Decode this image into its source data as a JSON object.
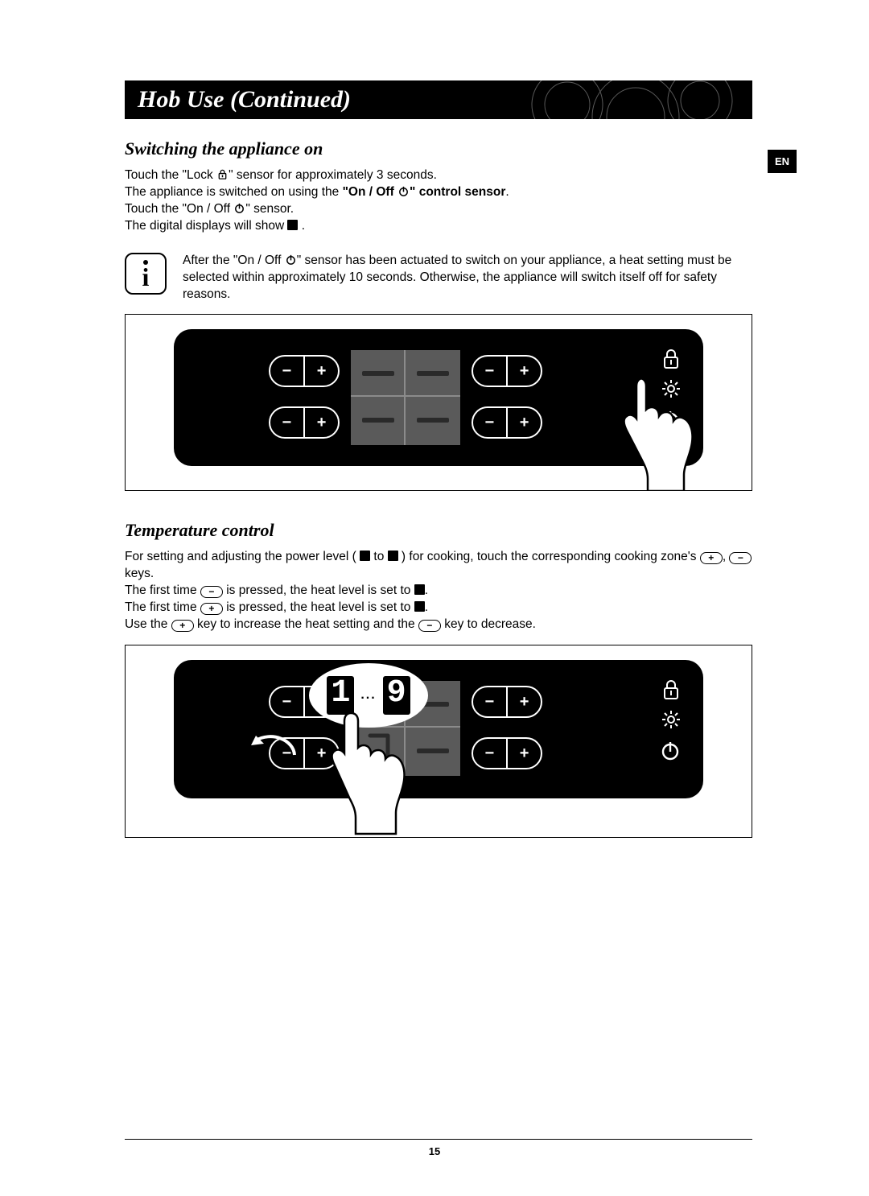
{
  "lang_tab": "EN",
  "page_title": "Hob Use (Continued)",
  "page_number": "15",
  "section1": {
    "heading": "Switching the appliance on",
    "line1a": "Touch the \"Lock ",
    "line1b": "\" sensor for approximately 3 seconds.",
    "line2a": "The appliance is switched on using the ",
    "line2b_bold": "\"On / Off ",
    "line2c_bold": "\" control sensor",
    "line2d": ".",
    "line3a": "Touch the \"On / Off ",
    "line3b": "\" sensor.",
    "line4a": "The digital displays will show ",
    "line4b": " .",
    "info": "After the \"On / Off Ⓘ\" sensor has been actuated to switch on your appliance, a heat setting must be selected within approximately 10 seconds. Otherwise, the appliance will switch itself off for safety reasons.",
    "info_a": "After the \"On / Off ",
    "info_b": "\" sensor has been actuated to switch on your appliance, a heat setting must be selected within approximately 10 seconds. Otherwise, the appliance will switch itself off for safety reasons."
  },
  "section2": {
    "heading": "Temperature control",
    "p1a": "For setting and adjusting the power level ( ",
    "p1b": " to ",
    "p1c": " ) for cooking, touch the corresponding cooking zone's ",
    "p1d": ", ",
    "p1e": " keys.",
    "p2a": "The first time ",
    "p2b": " is pressed, the heat level is set to ",
    "p2c": ".",
    "p3a": "The first time ",
    "p3b": " is pressed, the heat level is set to ",
    "p3c": ".",
    "p4a": "Use the ",
    "p4b": " key to increase the heat setting and the ",
    "p4c": " key to decrease."
  },
  "icons": {
    "plus": "+",
    "minus": "−",
    "bubble_left": "1",
    "bubble_mid": "...",
    "bubble_right": "9"
  }
}
